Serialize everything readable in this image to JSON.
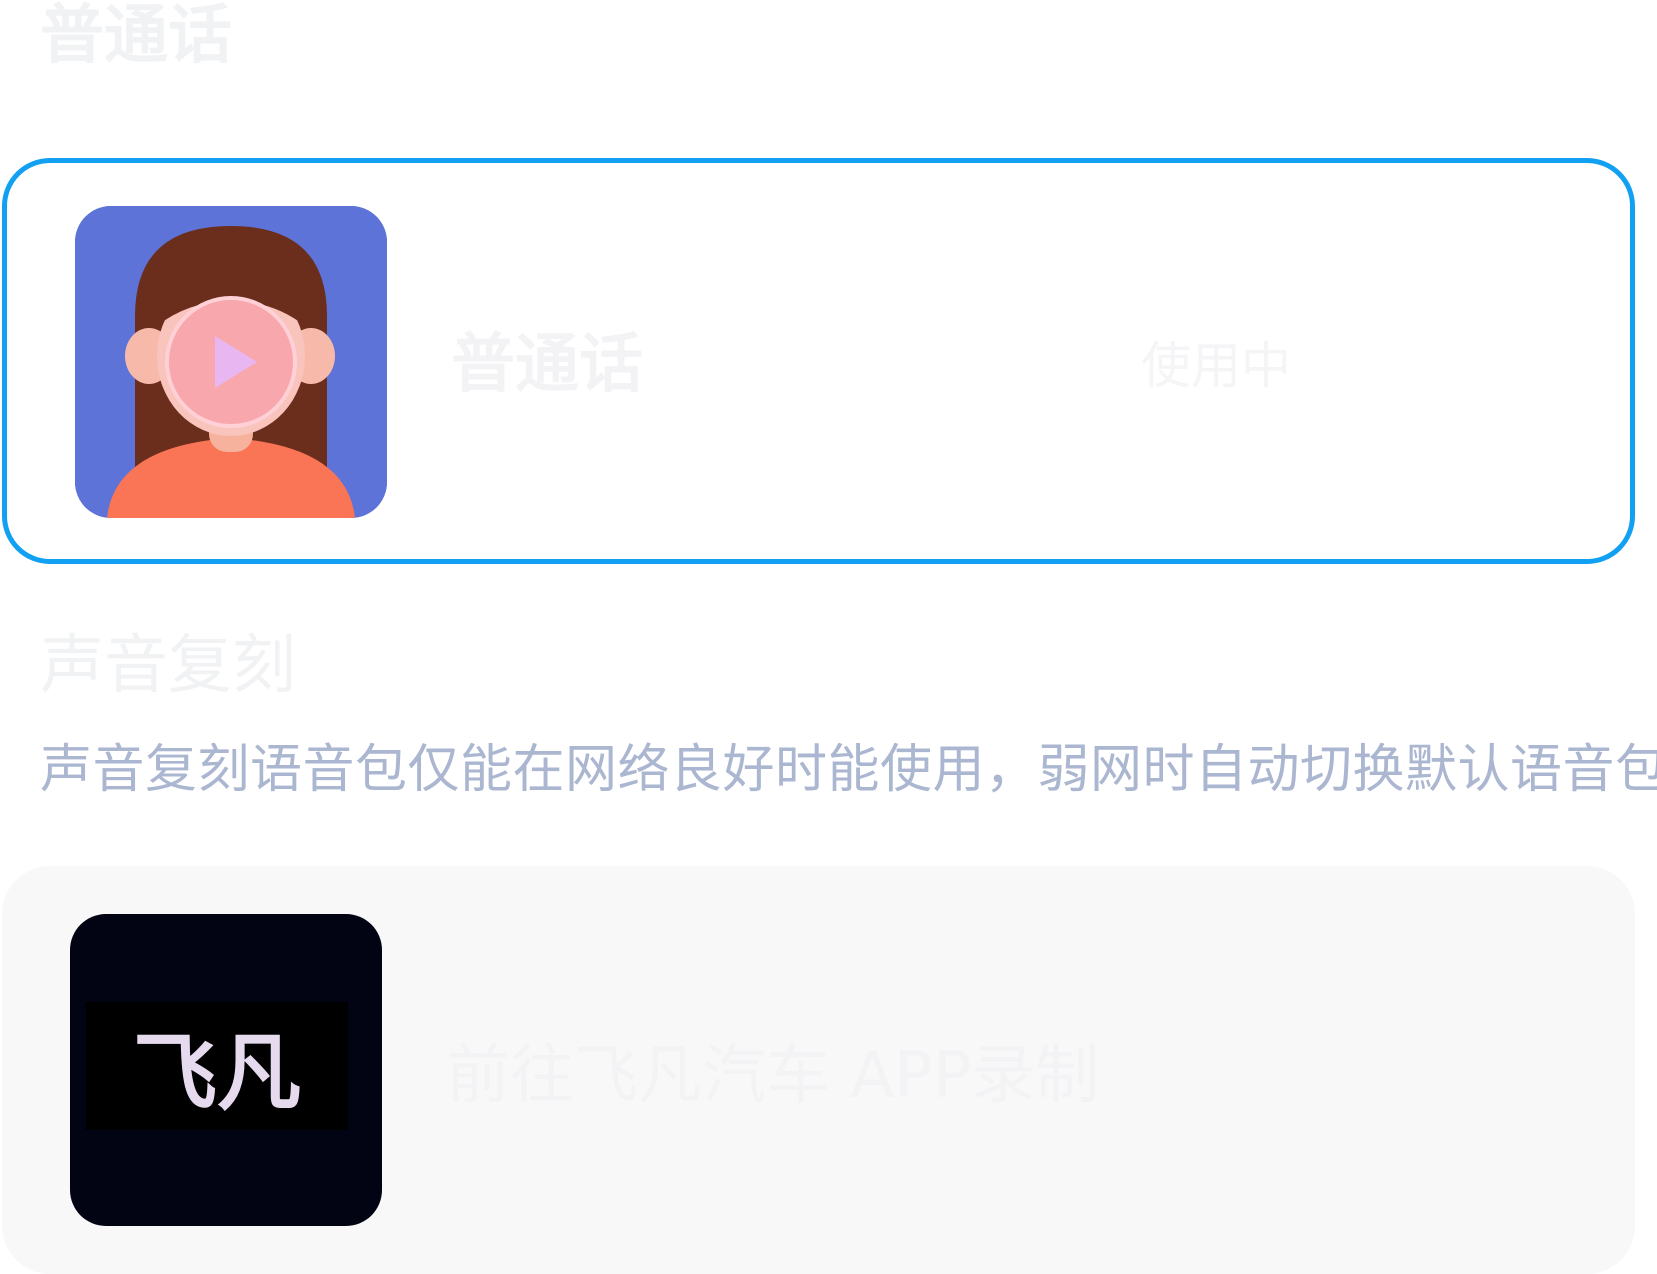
{
  "sections": {
    "mandarin": {
      "title": "普通话",
      "item": {
        "label": "普通话",
        "status": "使用中"
      }
    },
    "voice_clone": {
      "title": "声音复刻",
      "hint": "声音复刻语音包仅能在网络良好时能使用，弱网时自动切换默认语音包",
      "item": {
        "label": "前往飞凡汽车 APP录制",
        "logo_text": "飞凡"
      }
    }
  },
  "colors": {
    "selected_border": "#12a0f2",
    "hint_text": "#abb6d0",
    "avatar_bg": "#5d73d7",
    "logo_bg": "#020413"
  },
  "icons": {
    "avatar_overlay": "play-icon"
  }
}
